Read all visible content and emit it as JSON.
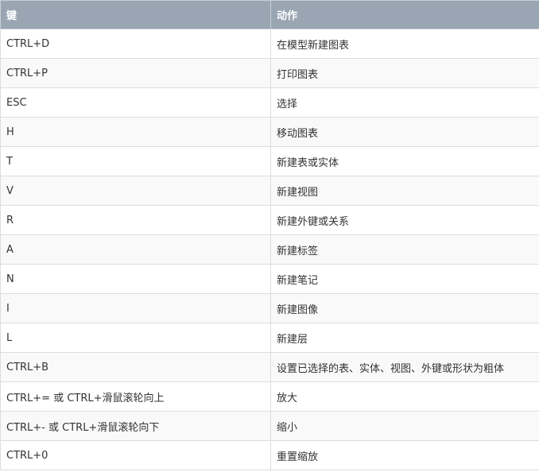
{
  "table": {
    "headers": [
      "键",
      "动作"
    ],
    "rows": [
      {
        "key": "CTRL+D",
        "action": "在模型新建图表"
      },
      {
        "key": "CTRL+P",
        "action": "打印图表"
      },
      {
        "key": "ESC",
        "action": "选择"
      },
      {
        "key": "H",
        "action": "移动图表"
      },
      {
        "key": "T",
        "action": "新建表或实体"
      },
      {
        "key": "V",
        "action": "新建视图"
      },
      {
        "key": "R",
        "action": "新建外键或关系"
      },
      {
        "key": "A",
        "action": "新建标签"
      },
      {
        "key": "N",
        "action": "新建笔记"
      },
      {
        "key": "I",
        "action": "新建图像"
      },
      {
        "key": "L",
        "action": "新建层"
      },
      {
        "key": "CTRL+B",
        "action": "设置已选择的表、实体、视图、外键或形状为粗体"
      },
      {
        "key": "CTRL+= 或 CTRL+滑鼠滚轮向上",
        "action": "放大"
      },
      {
        "key": "CTRL+- 或 CTRL+滑鼠滚轮向下",
        "action": "缩小"
      },
      {
        "key": "CTRL+0",
        "action": "重置缩放"
      }
    ]
  }
}
